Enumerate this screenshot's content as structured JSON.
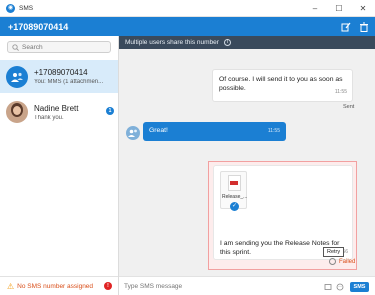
{
  "window": {
    "title": "SMS",
    "controls": {
      "minimize": "–",
      "maximize": "☐",
      "close": "✕"
    }
  },
  "header": {
    "number": "+17089070414",
    "icons": [
      "edit-icon",
      "trash-icon"
    ]
  },
  "sidebar": {
    "search_placeholder": "Search",
    "conversations": [
      {
        "name": "+17089070414",
        "preview": "You: MMS (1 attachmen...",
        "avatar_icon": "group-icon",
        "active": true
      },
      {
        "name": "Nadine Brett",
        "preview": "Thank you.",
        "avatar_icon": "user-photo",
        "unread": "1"
      }
    ],
    "footer": {
      "text": "No SMS number assigned",
      "badge": "!"
    }
  },
  "chat": {
    "banner": {
      "text": "Multiple users share this number",
      "info": "i"
    },
    "messages": [
      {
        "direction": "incoming",
        "text": "Of course. I will send it to you as soon as possible.",
        "time": "11:55",
        "status": "Sent"
      },
      {
        "direction": "outgoing",
        "text": "Great!",
        "time": "11:55"
      },
      {
        "direction": "failed",
        "attachment_name": "Release_...",
        "text": "I am sending you the Release Notes for this sprint.",
        "time": "11:56",
        "tooltip": "Retry",
        "status": "Failed"
      }
    ],
    "composer": {
      "placeholder": "Type SMS message",
      "send_label": "SMS"
    }
  },
  "colors": {
    "accent": "#1b7fd3",
    "banner": "#3a4a5c",
    "error": "#d94f1a",
    "warning": "#f39c12"
  }
}
